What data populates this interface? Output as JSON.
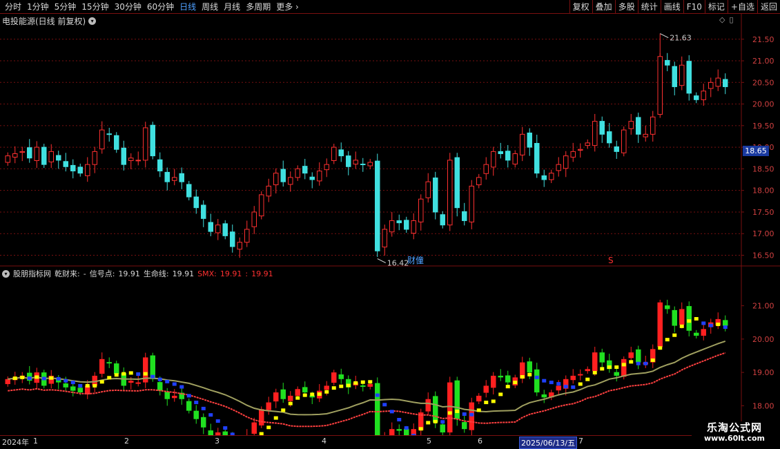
{
  "toolbar": {
    "periods": [
      "分时",
      "1分钟",
      "5分钟",
      "15分钟",
      "30分钟",
      "60分钟",
      "日线",
      "周线",
      "月线",
      "多周期",
      "更多"
    ],
    "active_period": "日线",
    "more_arrow": "›",
    "right_buttons": [
      "复权",
      "叠加",
      "多股",
      "统计",
      "画线",
      "F10",
      "标记",
      "+自选",
      "返回"
    ]
  },
  "price_panel": {
    "title": "电投能源(日线 前复权)",
    "dropdown_glyph": "▾",
    "icon_diamond": "◇",
    "icon_window": "▯",
    "y_axis_labels": [
      "21.50",
      "21.00",
      "20.50",
      "20.00",
      "19.50",
      "19.00",
      "18.50",
      "18.00",
      "17.50",
      "17.00",
      "16.50"
    ],
    "current_price_tag": "18.65",
    "high_marker": "21.63",
    "low_marker": "16.42",
    "event_caibao": "财",
    "event_caibao2": "僮",
    "event_s": "S"
  },
  "indicator_panel": {
    "collapse_glyph": "▾",
    "name": "股朋指标网",
    "qiancai_label": "乾财来:",
    "qiancai_value": "-",
    "signal_label": "信号点:",
    "signal_value": "19.91",
    "life_label": "生命线:",
    "life_value": "19.91",
    "smx_label": "SMX:",
    "smx_value1": "19.91",
    "smx_sep": ":",
    "smx_value2": "19.91",
    "y_axis_labels": [
      "21.00",
      "20.00",
      "19.00",
      "18.00"
    ]
  },
  "date_bar": {
    "year": "2024年",
    "months": [
      "1",
      "2",
      "3",
      "4",
      "5",
      "6",
      "7"
    ],
    "selected_date": "2025/06/13/五"
  },
  "watermark": {
    "line1": "乐淘公式网",
    "line2": "www.60lt.com"
  },
  "colors": {
    "up": "#ff3030",
    "down": "#40e0e0",
    "grid": "#7a1010",
    "ind_up": "#ff2020",
    "ind_down": "#20e020",
    "signal_up": "#ffff00",
    "signal_down": "#2040ff",
    "life_line": "#a0a060"
  },
  "chart_data": {
    "type": "candlestick",
    "y_range": [
      16.3,
      21.8
    ],
    "closes": [
      18.8,
      18.85,
      18.9,
      18.75,
      19.0,
      18.6,
      18.9,
      18.7,
      18.55,
      18.45,
      18.4,
      18.6,
      18.9,
      19.4,
      19.3,
      18.95,
      18.6,
      18.75,
      18.7,
      19.45,
      18.8,
      18.45,
      18.2,
      18.3,
      18.2,
      17.85,
      17.6,
      17.35,
      17.05,
      17.2,
      16.95,
      16.7,
      16.8,
      17.1,
      17.5,
      17.9,
      18.1,
      18.4,
      18.2,
      18.3,
      18.5,
      18.4,
      18.25,
      18.45,
      18.6,
      19.0,
      18.8,
      18.55,
      18.7,
      18.6,
      18.65,
      16.6,
      17.1,
      17.3,
      17.25,
      17.1,
      17.3,
      17.8,
      18.2,
      17.5,
      17.2,
      18.7,
      17.6,
      17.3,
      18.1,
      18.3,
      18.6,
      18.9,
      18.85,
      18.7,
      18.85,
      19.3,
      19.0,
      18.4,
      18.25,
      18.4,
      18.6,
      18.8,
      18.9,
      18.95,
      19.1,
      19.6,
      19.3,
      19.1,
      18.9,
      19.4,
      19.6,
      19.3,
      19.3,
      19.7,
      21.1,
      20.9,
      20.4,
      20.9,
      20.25,
      20.1,
      20.3,
      20.5,
      20.6,
      20.4
    ],
    "high_value": 21.63,
    "low_value": 16.42,
    "current": 18.65
  }
}
